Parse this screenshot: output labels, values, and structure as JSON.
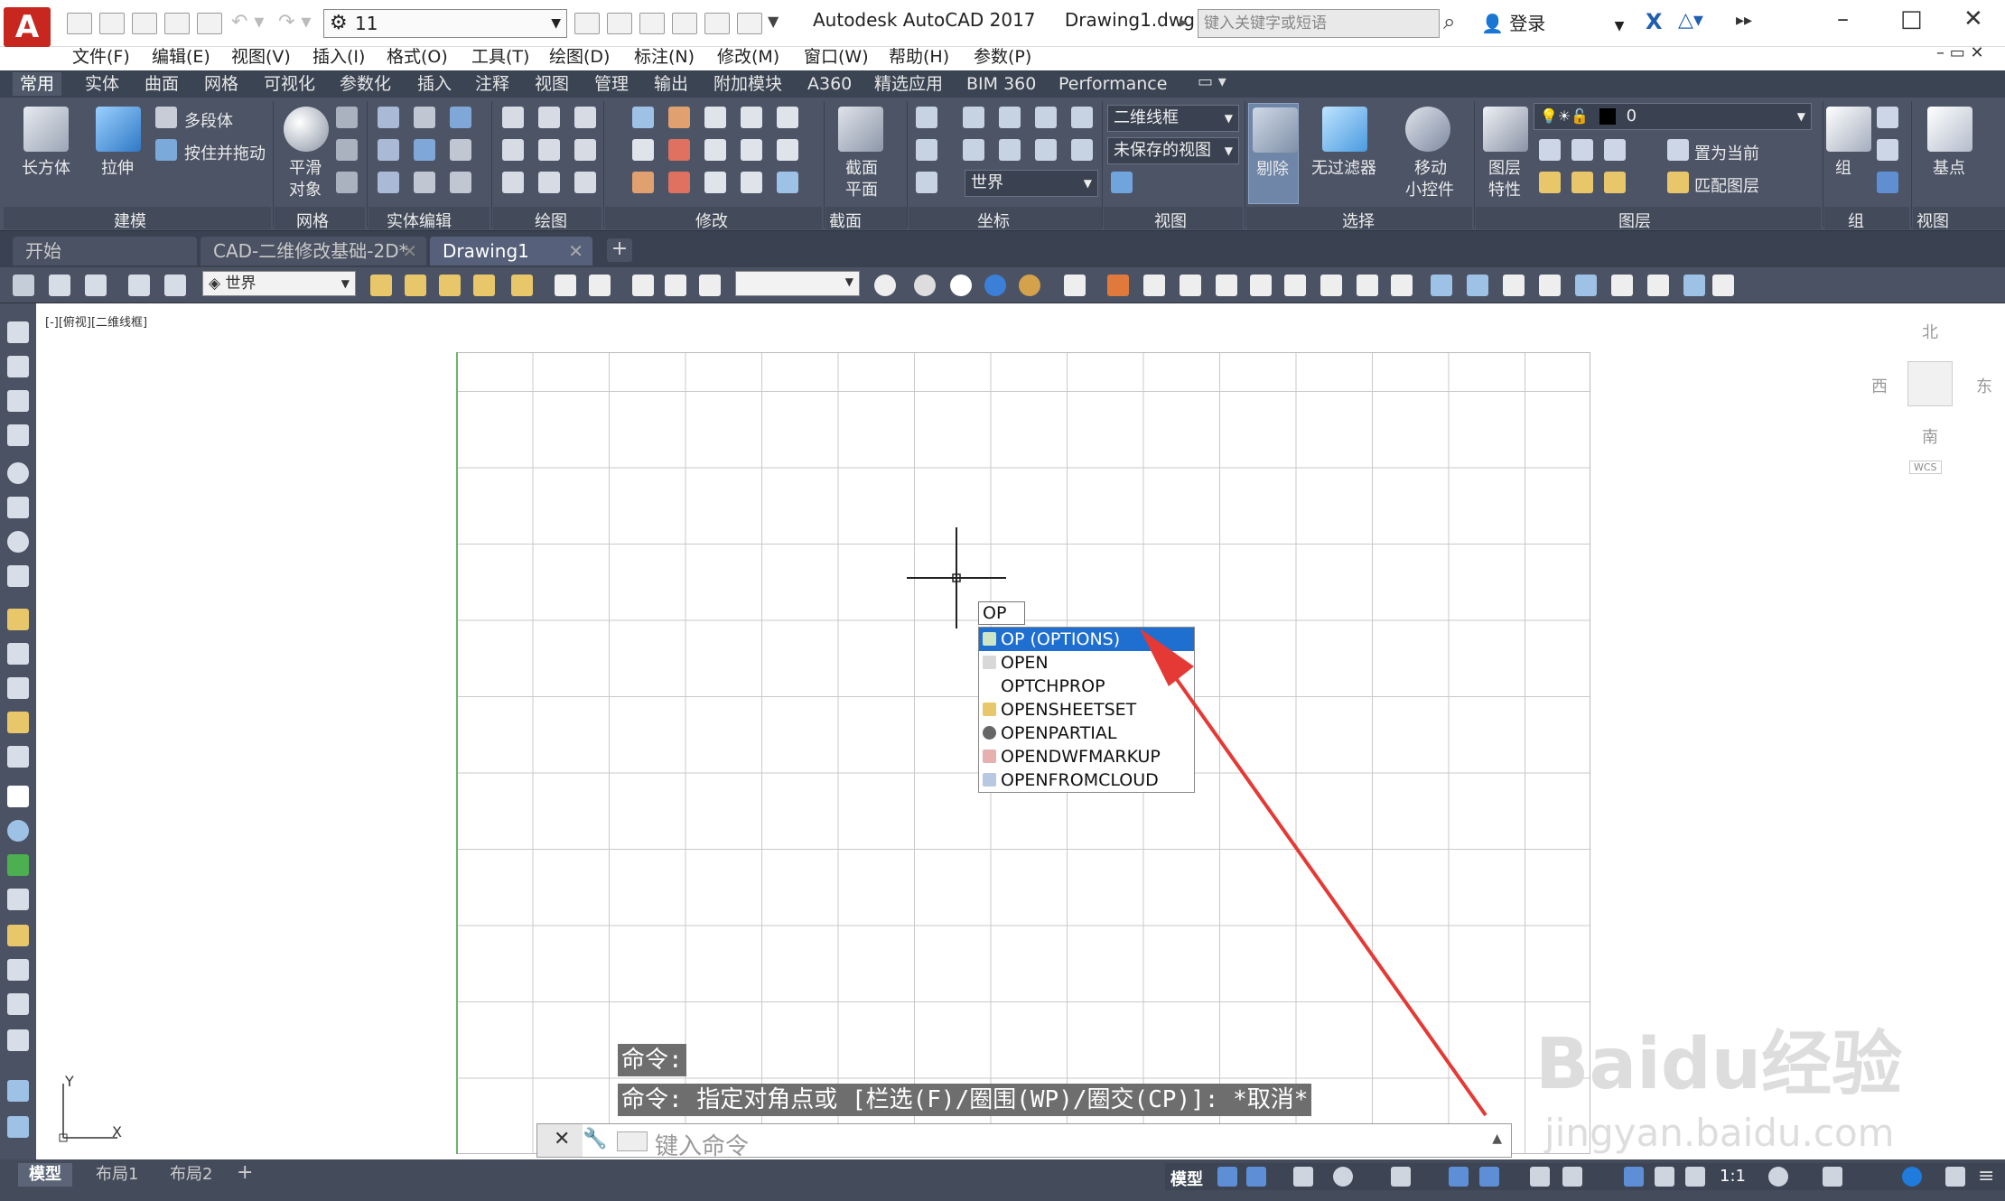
{
  "title_bar": {
    "logo": "A",
    "workspace": "11",
    "app_name": "Autodesk AutoCAD 2017",
    "file_name": "Drawing1.dwg",
    "search_placeholder": "键入关键字或短语",
    "login": "登录"
  },
  "menus": [
    "文件(F)",
    "编辑(E)",
    "视图(V)",
    "插入(I)",
    "格式(O)",
    "工具(T)",
    "绘图(D)",
    "标注(N)",
    "修改(M)",
    "窗口(W)",
    "帮助(H)",
    "参数(P)"
  ],
  "ribbon_tabs": [
    "常用",
    "实体",
    "曲面",
    "网格",
    "可视化",
    "参数化",
    "插入",
    "注释",
    "视图",
    "管理",
    "输出",
    "附加模块",
    "A360",
    "精选应用",
    "BIM 360",
    "Performance"
  ],
  "ribbon": {
    "box_label": "长方体",
    "extrude_label": "拉伸",
    "polysolid_label": "多段体",
    "presspull_label": "按住并拖动",
    "smooth_label_1": "平滑",
    "smooth_label_2": "对象",
    "section_label_1": "截面",
    "section_label_2": "平面",
    "visual_style": "二维线框",
    "saved_view": "未保存的视图",
    "ucs_world": "世界",
    "cull_label": "剔除",
    "nofilter_label": "无过滤器",
    "gizmo_label_1": "移动",
    "gizmo_label_2": "小控件",
    "layerprops_label_1": "图层",
    "layerprops_label_2": "特性",
    "layer_current": "0",
    "set_current": "置为当前",
    "match_layer": "匹配图层",
    "group_label": "组",
    "base_label": "基点",
    "panels": [
      "建模",
      "网格",
      "实体编辑",
      "绘图",
      "修改",
      "截面",
      "坐标",
      "视图",
      "选择",
      "图层",
      "组",
      "视图"
    ]
  },
  "doc_tabs": [
    "开始",
    "CAD-二维修改基础-2D*",
    "Drawing1"
  ],
  "toolbar": {
    "ucs_dropdown": "世界"
  },
  "viewport_label": "[-][俯视][二维线框]",
  "compass": {
    "north": "北",
    "south": "南",
    "east": "东",
    "west": "西",
    "wcs": "WCS"
  },
  "autocomplete": {
    "typed": "OP",
    "items": [
      "OP (OPTIONS)",
      "OPEN",
      "OPTCHPROP",
      "OPENSHEETSET",
      "OPENPARTIAL",
      "OPENDWFMARKUP",
      "OPENFROMCLOUD"
    ],
    "selected_index": 0
  },
  "command": {
    "history_1": "命令:",
    "history_2": "命令: 指定对角点或 [栏选(F)/圈围(WP)/圈交(CP)]: *取消*",
    "placeholder": "键入命令"
  },
  "ucs_icon": {
    "x": "X",
    "y": "Y"
  },
  "layout_tabs": [
    "模型",
    "布局1",
    "布局2"
  ],
  "status": {
    "model": "模型",
    "scale": "1:1"
  },
  "watermark": {
    "line1": "Baidu经验",
    "line2": "jingyan.baidu.com"
  }
}
